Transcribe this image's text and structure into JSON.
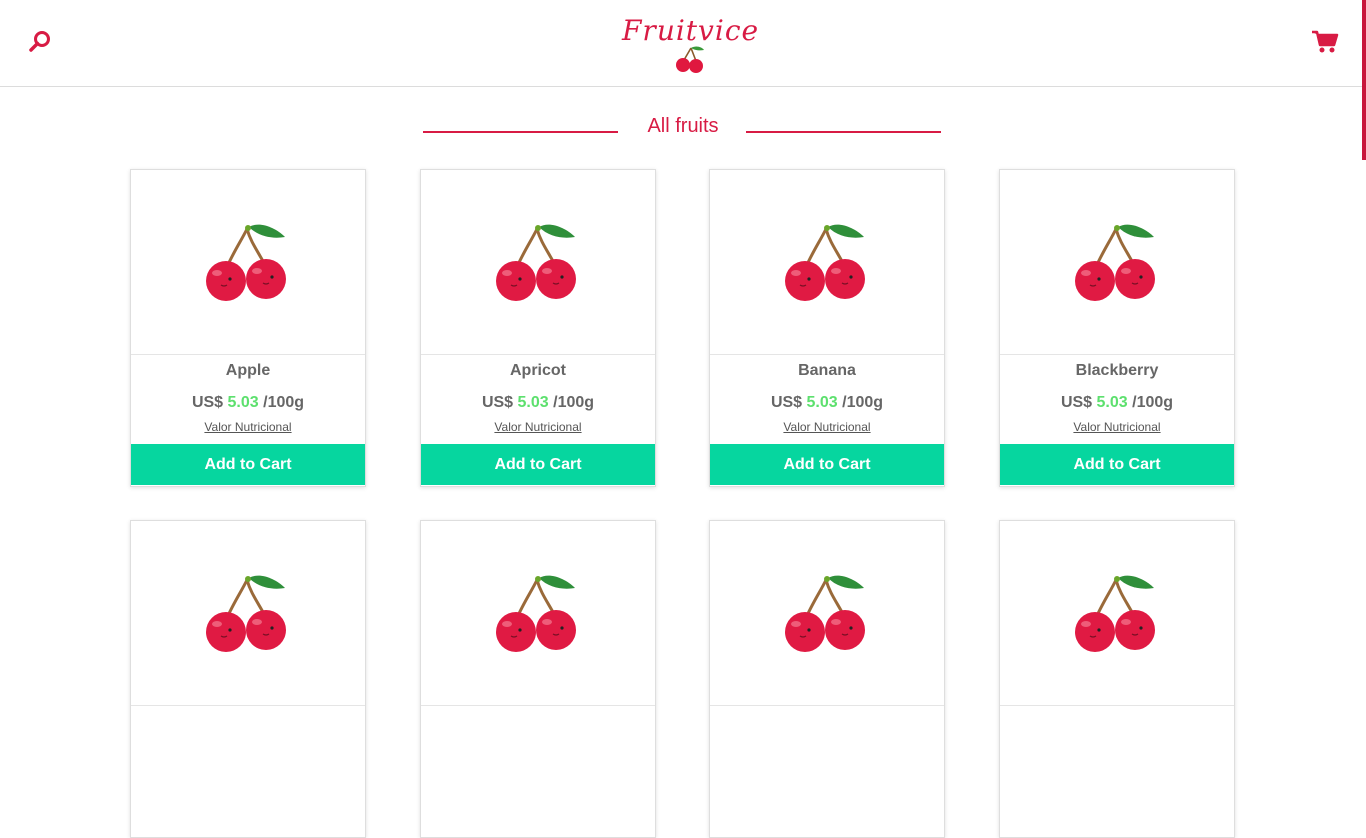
{
  "header": {
    "logo_text": "Fruitvice",
    "search_icon": "search-icon",
    "cart_icon": "shopping-cart-icon"
  },
  "colors": {
    "brand": "#d81b44",
    "add_to_cart": "#06d69f",
    "price_value": "#5de06e"
  },
  "section": {
    "title": "All fruits"
  },
  "products": [
    {
      "name": "Apple",
      "currency": "US$",
      "price": "5.03",
      "unit": "/100g",
      "link": "Valor Nutricional",
      "button": "Add to Cart",
      "icon": "cherry-icon"
    },
    {
      "name": "Apricot",
      "currency": "US$",
      "price": "5.03",
      "unit": "/100g",
      "link": "Valor Nutricional",
      "button": "Add to Cart",
      "icon": "cherry-icon"
    },
    {
      "name": "Banana",
      "currency": "US$",
      "price": "5.03",
      "unit": "/100g",
      "link": "Valor Nutricional",
      "button": "Add to Cart",
      "icon": "cherry-icon"
    },
    {
      "name": "Blackberry",
      "currency": "US$",
      "price": "5.03",
      "unit": "/100g",
      "link": "Valor Nutricional",
      "button": "Add to Cart",
      "icon": "cherry-icon"
    },
    {
      "icon": "cherry-icon"
    },
    {
      "icon": "cherry-icon"
    },
    {
      "icon": "cherry-icon"
    },
    {
      "icon": "cherry-icon"
    }
  ]
}
